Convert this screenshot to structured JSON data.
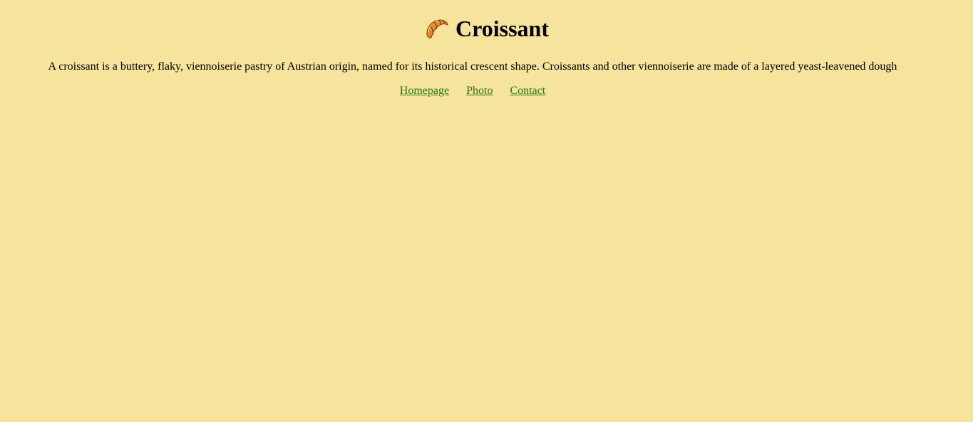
{
  "page": {
    "background_color": "#f6e49c",
    "link_color": "#1f7a12"
  },
  "header": {
    "icon": "croissant-icon",
    "title": "Croissant"
  },
  "main": {
    "description": "A croissant is a buttery, flaky, viennoiserie pastry of Austrian origin, named for its historical crescent shape. Croissants and other viennoiserie are made of a layered yeast-leavened dough"
  },
  "nav": {
    "links": [
      {
        "label": "Homepage"
      },
      {
        "label": "Photo"
      },
      {
        "label": "Contact"
      }
    ]
  }
}
